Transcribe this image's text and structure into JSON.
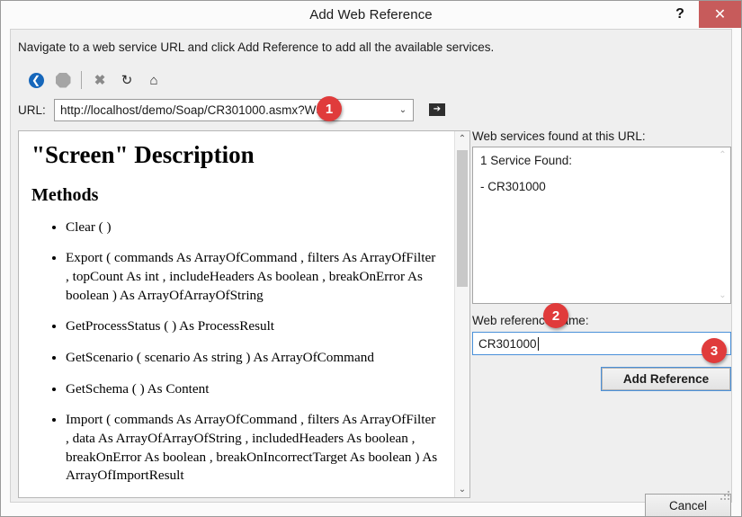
{
  "window": {
    "title": "Add Web Reference",
    "help_label": "?",
    "close_label": "✕"
  },
  "instruction": "Navigate to a web service URL and click Add Reference to add all the available services.",
  "toolbar": {
    "back_label": "❮",
    "forward_label": "",
    "stop_label": "✖",
    "refresh_label": "↻",
    "home_label": "⌂"
  },
  "url_row": {
    "label": "URL:",
    "value": "http://localhost/demo/Soap/CR301000.asmx?WSDL",
    "placeholder": "http://",
    "dropdown_arrow": "⌄",
    "go_label": "➔"
  },
  "document": {
    "heading": "\"Screen\" Description",
    "subheading": "Methods",
    "methods": [
      "Clear ( )",
      "Export ( commands As ArrayOfCommand ,  filters As ArrayOfFilter ,  topCount As int ,  includeHeaders As boolean ,  breakOnError As boolean ) As ArrayOfArrayOfString",
      "GetProcessStatus ( ) As ProcessResult",
      "GetScenario ( scenario As string ) As ArrayOfCommand",
      "GetSchema ( ) As Content",
      "Import ( commands As ArrayOfCommand ,  filters As ArrayOfFilter ,  data As ArrayOfArrayOfString ,  includedHeaders As boolean ,  breakOnError As boolean ,  breakOnIncorrectTarget As boolean ) As ArrayOfImportResult"
    ]
  },
  "scrollbar": {
    "up_arrow": "⌃",
    "down_arrow": "⌄"
  },
  "services": {
    "label": "Web services found at this URL:",
    "found_text": "1 Service Found:",
    "items": [
      "- CR301000"
    ]
  },
  "reference_name": {
    "label": "Web reference name:",
    "value": "CR301000",
    "placeholder": ""
  },
  "buttons": {
    "add_reference": "Add Reference",
    "cancel": "Cancel"
  },
  "badges": {
    "one": "1",
    "two": "2",
    "three": "3"
  },
  "colors": {
    "badge_red": "#e03b3b",
    "close_red": "#c75b5b",
    "focus_blue": "#4a90d9",
    "back_blue": "#1667bb"
  }
}
